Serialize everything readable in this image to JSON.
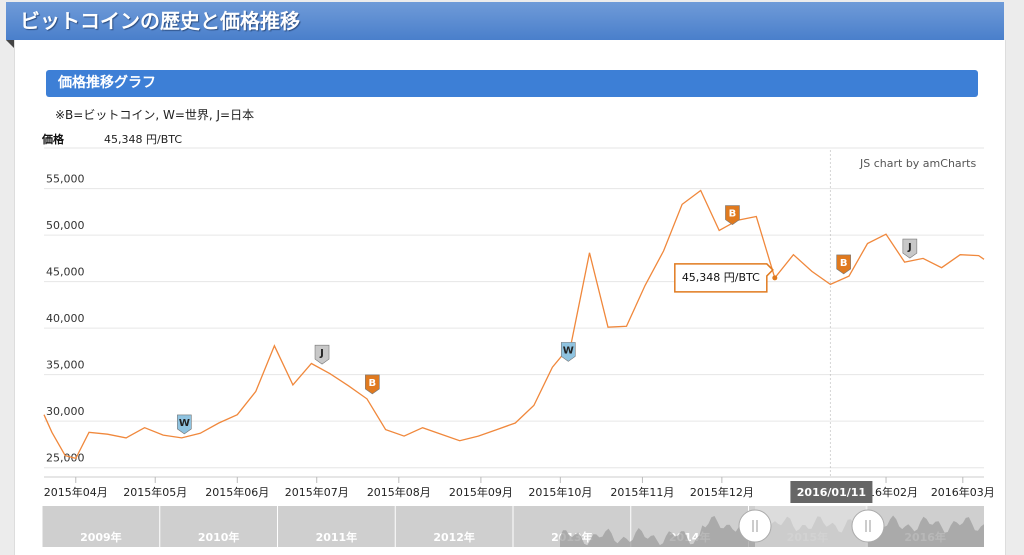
{
  "header": {
    "title": "ビットコインの歴史と価格推移"
  },
  "section": {
    "title": "価格推移グラフ"
  },
  "legend_note": "※B=ビットコイン, W=世界, J=日本",
  "price_label": "価格",
  "price_value": "45,348 円/BTC",
  "credit": "JS chart by amCharts",
  "tooltip": "45,348 円/BTC",
  "cursor_date": "2016/01/11",
  "colors": {
    "line": "#f0883c",
    "flag_b": "#e07a1f",
    "flag_w": "#8fc3e0",
    "flag_j": "#c8c8c8",
    "banner": "#4a7fcb"
  },
  "chart_data": {
    "type": "line",
    "series": [
      {
        "values": [
          [
            "2015-03-20",
            30700
          ],
          [
            "2015-03-23",
            28800
          ],
          [
            "2015-03-28",
            26300
          ],
          [
            "2015-04-01",
            26000
          ],
          [
            "2015-04-06",
            28800
          ],
          [
            "2015-04-13",
            28600
          ],
          [
            "2015-04-20",
            28200
          ],
          [
            "2015-04-27",
            29300
          ],
          [
            "2015-05-04",
            28500
          ],
          [
            "2015-05-11",
            28200
          ],
          [
            "2015-05-18",
            28700
          ],
          [
            "2015-05-25",
            29800
          ],
          [
            "2015-06-01",
            30700
          ],
          [
            "2015-06-08",
            33200
          ],
          [
            "2015-06-15",
            38100
          ],
          [
            "2015-06-22",
            33900
          ],
          [
            "2015-06-29",
            36200
          ],
          [
            "2015-07-06",
            35100
          ],
          [
            "2015-07-13",
            33800
          ],
          [
            "2015-07-20",
            32400
          ],
          [
            "2015-07-27",
            29100
          ],
          [
            "2015-08-03",
            28400
          ],
          [
            "2015-08-10",
            29300
          ],
          [
            "2015-08-17",
            28600
          ],
          [
            "2015-08-24",
            27900
          ],
          [
            "2015-08-31",
            28400
          ],
          [
            "2015-09-07",
            29100
          ],
          [
            "2015-09-14",
            29800
          ],
          [
            "2015-09-21",
            31700
          ],
          [
            "2015-09-28",
            35800
          ],
          [
            "2015-10-05",
            38200
          ],
          [
            "2015-10-12",
            48100
          ],
          [
            "2015-10-19",
            40100
          ],
          [
            "2015-10-26",
            40200
          ],
          [
            "2015-11-02",
            44600
          ],
          [
            "2015-11-09",
            48300
          ],
          [
            "2015-11-16",
            53300
          ],
          [
            "2015-11-23",
            54800
          ],
          [
            "2015-11-30",
            50500
          ],
          [
            "2015-12-07",
            51600
          ],
          [
            "2015-12-14",
            52000
          ],
          [
            "2015-12-21",
            45400
          ],
          [
            "2015-12-28",
            47900
          ],
          [
            "2016-01-04",
            46100
          ],
          [
            "2016-01-11",
            44700
          ],
          [
            "2016-01-18",
            45600
          ],
          [
            "2016-01-25",
            49100
          ],
          [
            "2016-02-01",
            50100
          ],
          [
            "2016-02-08",
            47100
          ],
          [
            "2016-02-15",
            47500
          ],
          [
            "2016-02-22",
            46500
          ],
          [
            "2016-02-29",
            47900
          ],
          [
            "2016-03-07",
            47800
          ],
          [
            "2016-03-09",
            47400
          ]
        ]
      }
    ],
    "y_ticks": [
      "25,000",
      "30,000",
      "35,000",
      "40,000",
      "45,000",
      "50,000",
      "55,000"
    ],
    "ylim": [
      24000,
      57000
    ],
    "x_ticks": [
      [
        "2015-04-01",
        "2015年04月"
      ],
      [
        "2015-05-01",
        "2015年05月"
      ],
      [
        "2015-06-01",
        "2015年06月"
      ],
      [
        "2015-07-01",
        "2015年07月"
      ],
      [
        "2015-08-01",
        "2015年08月"
      ],
      [
        "2015-09-01",
        "2015年09月"
      ],
      [
        "2015-10-01",
        "2015年10月"
      ],
      [
        "2015-11-01",
        "2015年11月"
      ],
      [
        "2015-12-01",
        "2015年12月"
      ],
      [
        "2016-02-01",
        "2016年02月"
      ],
      [
        "2016-03-01",
        "2016年03月"
      ]
    ],
    "events": [
      {
        "date": "2015-05-12",
        "value": 28200,
        "flag": "W"
      },
      {
        "date": "2015-07-03",
        "value": 35700,
        "flag": "J"
      },
      {
        "date": "2015-07-22",
        "value": 32500,
        "flag": "B"
      },
      {
        "date": "2015-10-04",
        "value": 36000,
        "flag": "W"
      },
      {
        "date": "2015-12-05",
        "value": 50700,
        "flag": "B"
      },
      {
        "date": "2016-01-16",
        "value": 45400,
        "flag": "B"
      },
      {
        "date": "2016-02-10",
        "value": 47100,
        "flag": "J"
      }
    ],
    "scrollbar_years": [
      "2009年",
      "2010年",
      "2011年",
      "2012年",
      "2013年",
      "2014年",
      "2015年",
      "2016年"
    ]
  }
}
